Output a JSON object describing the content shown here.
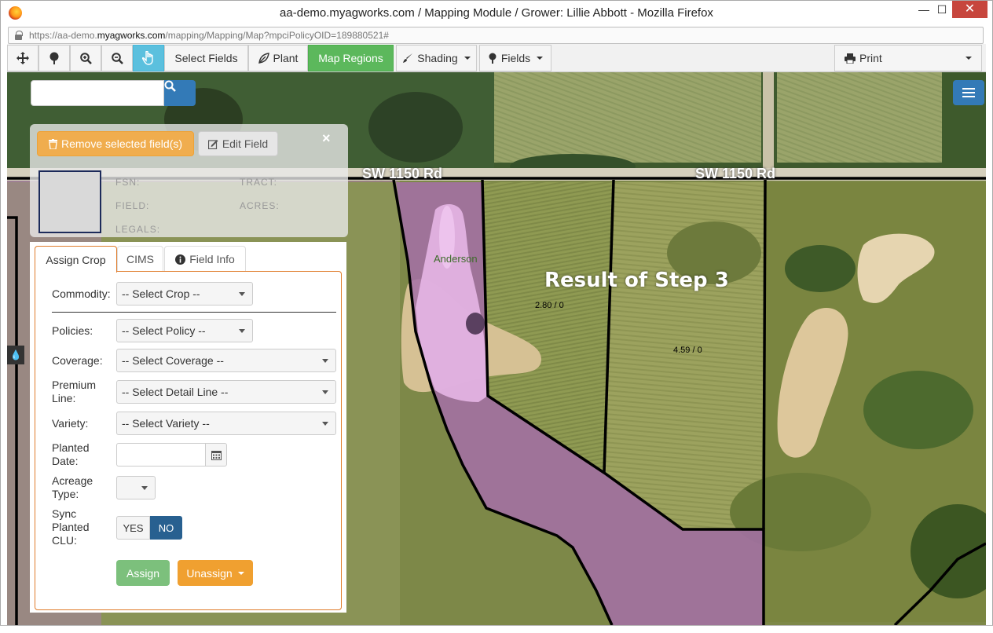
{
  "window": {
    "title": "aa-demo.myagworks.com / Mapping Module / Grower: Lillie Abbott - Mozilla Firefox",
    "minimize": "—",
    "maximize": "☐",
    "close": "✕"
  },
  "address_bar": {
    "url_prefix": "https://aa-demo.",
    "url_domain": "myagworks.com",
    "url_path": "/mapping/Mapping/Map?mpciPolicyOID=189880521#"
  },
  "toolbar": {
    "select_fields": "Select Fields",
    "plant": "Plant",
    "map_regions": "Map Regions",
    "shading": "Shading",
    "fields": "Fields",
    "print": "Print"
  },
  "map": {
    "road_label_1": "SW 1150 Rd",
    "road_label_2": "SW 1150 Rd",
    "step_label": "Result of Step 3",
    "field_name_label": "Anderson",
    "field_value_1": "2.80 / 0",
    "field_value_2": "4.59 / 0"
  },
  "field_panel": {
    "remove_button": "Remove selected field(s)",
    "edit_button": "Edit Field",
    "close": "×",
    "fsn_label": "FSN:",
    "tract_label": "TRACT:",
    "field_label": "FIELD:",
    "acres_label": "ACRES:",
    "legals_label": "LEGALS:"
  },
  "tabs": {
    "assign_crop": "Assign Crop",
    "cims": "CIMS",
    "field_info": "Field Info"
  },
  "form": {
    "commodity_label": "Commodity:",
    "commodity_value": "-- Select Crop --",
    "policies_label": "Policies:",
    "policies_value": "-- Select Policy --",
    "coverage_label": "Coverage:",
    "coverage_value": "-- Select Coverage --",
    "premium_line_label_1": "Premium",
    "premium_line_label_2": "Line:",
    "premium_line_value": "-- Select Detail Line --",
    "variety_label": "Variety:",
    "variety_value": "-- Select Variety --",
    "planted_date_label_1": "Planted",
    "planted_date_label_2": "Date:",
    "acreage_type_label_1": "Acreage",
    "acreage_type_label_2": "Type:",
    "sync_label_1": "Sync",
    "sync_label_2": "Planted",
    "sync_label_3": "CLU:",
    "yes": "YES",
    "no": "NO",
    "assign": "Assign",
    "unassign": "Unassign"
  },
  "colors": {
    "orange": "#f0ad4e",
    "green": "#5cb85c",
    "blue": "#337ab7",
    "tab_border": "#e07b2a"
  }
}
